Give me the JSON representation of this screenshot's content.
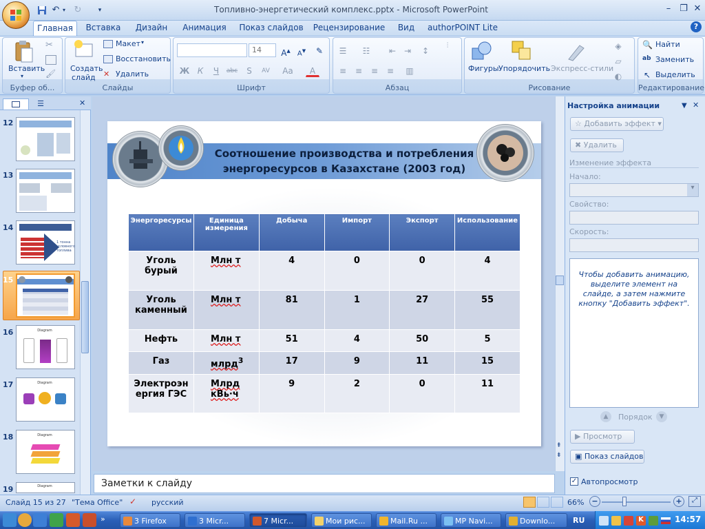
{
  "app": {
    "title": "Топливно-энергетический комплекс.pptx - Microsoft PowerPoint"
  },
  "ribbon": {
    "tabs": [
      "Главная",
      "Вставка",
      "Дизайн",
      "Анимация",
      "Показ слайдов",
      "Рецензирование",
      "Вид",
      "authorPOINT Lite"
    ],
    "active_tab": "Главная",
    "clipboard": {
      "paste": "Вставить",
      "label": "Буфер об..."
    },
    "slides": {
      "create": "Создать",
      "create2": "слайд",
      "layout": "Макет",
      "reset": "Восстановить",
      "delete": "Удалить",
      "label": "Слайды"
    },
    "font": {
      "size": "14",
      "label": "Шрифт"
    },
    "paragraph": {
      "label": "Абзац"
    },
    "drawing": {
      "shapes": "Фигуры",
      "arrange": "Упорядочить",
      "styles": "Экспресс-стили",
      "label": "Рисование"
    },
    "editing": {
      "find": "Найти",
      "replace": "Заменить",
      "select": "Выделить",
      "label": "Редактирование"
    }
  },
  "thumbnails": {
    "numbers": [
      "12",
      "13",
      "14",
      "15",
      "16",
      "17",
      "18",
      "19"
    ],
    "selected": "15",
    "slide14_text": "1 тонна условного топлива",
    "slide16_title": "Diagram",
    "slide17_title": "Diagram",
    "slide18_title": "Diagram",
    "slide19_title": "Diagram"
  },
  "slide": {
    "title_line1": "Соотношение производства  и потребления",
    "title_line2": "энергоресурсов в Казахстане (2003 год)",
    "table": {
      "headers": [
        "Энергоресурсы",
        "Единица измерения",
        "Добыча",
        "Импорт",
        "Экспорт",
        "Использование"
      ],
      "rows": [
        {
          "name": "Уголь бурый",
          "unit": "Млн т",
          "prod": "4",
          "imp": "0",
          "exp": "0",
          "use": "4"
        },
        {
          "name": "Уголь каменный",
          "unit": "Млн т",
          "prod": "81",
          "imp": "1",
          "exp": "27",
          "use": "55"
        },
        {
          "name": "Нефть",
          "unit": "Млн т",
          "prod": "51",
          "imp": "4",
          "exp": "50",
          "use": "5"
        },
        {
          "name": "Газ",
          "unit": "млрд",
          "unit_sup": "3",
          "prod": "17",
          "imp": "9",
          "exp": "11",
          "use": "15"
        },
        {
          "name": "Электроэн ергия ГЭС",
          "unit": "Млрд кВь·ч",
          "prod": "9",
          "imp": "2",
          "exp": "0",
          "use": "11"
        }
      ]
    }
  },
  "notes": {
    "placeholder": "Заметки к слайду"
  },
  "animation_pane": {
    "title": "Настройка анимации",
    "add_effect": "Добавить эффект",
    "remove": "Удалить",
    "change_effect": "Изменение эффекта",
    "start": "Начало:",
    "property": "Свойство:",
    "speed": "Скорость:",
    "hint": "Чтобы добавить анимацию, выделите элемент на слайде, а затем нажмите кнопку \"Добавить эффект\".",
    "order": "Порядок",
    "preview": "Просмотр",
    "slideshow": "Показ слайдов",
    "autopreview": "Автопросмотр"
  },
  "status": {
    "slide": "Слайд 15 из 27",
    "theme": "\"Тема Office\"",
    "language": "русский",
    "zoom": "66%"
  },
  "taskbar": {
    "items": [
      "3 Firefox",
      "3 Micr...",
      "7 Micr...",
      "Мои рис...",
      "Mail.Ru ...",
      "MP Navi...",
      "Downlo..."
    ],
    "lang": "RU",
    "time": "14:57"
  },
  "colors": {
    "accent": "#15428b",
    "selection": "#f6a54a",
    "table_header": "#3f62a8"
  }
}
